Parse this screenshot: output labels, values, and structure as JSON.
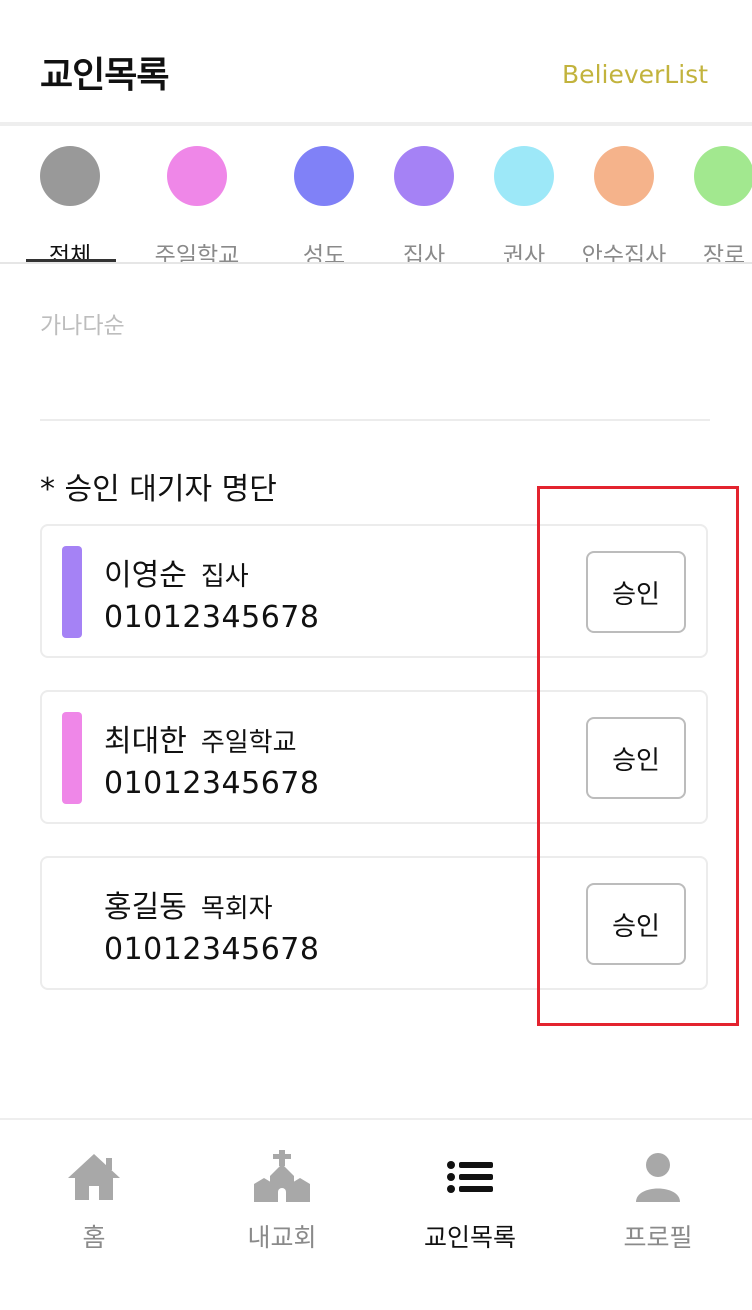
{
  "header": {
    "title": "교인목록",
    "subtitle": "BelieverList"
  },
  "categories": [
    {
      "label": "전체",
      "color": "#999999",
      "active": true
    },
    {
      "label": "주일학교",
      "color": "#ef87e8"
    },
    {
      "label": "성도",
      "color": "#8081f7"
    },
    {
      "label": "집사",
      "color": "#a582f5"
    },
    {
      "label": "권사",
      "color": "#9de8f8"
    },
    {
      "label": "안수집사",
      "color": "#f5b38b"
    },
    {
      "label": "장로",
      "color": "#a2e88f"
    }
  ],
  "sort": {
    "label": "가나다순"
  },
  "pending": {
    "title": "* 승인 대기자 명단",
    "members": [
      {
        "name": "이영순",
        "role": "집사",
        "phone": "01012345678",
        "bar_color": "#a582f5",
        "action": "승인"
      },
      {
        "name": "최대한",
        "role": "주일학교",
        "phone": "01012345678",
        "bar_color": "#ef87e8",
        "action": "승인"
      },
      {
        "name": "홍길동",
        "role": "목회자",
        "phone": "01012345678",
        "bar_color": "",
        "action": "승인"
      }
    ]
  },
  "bottom_nav": [
    {
      "label": "홈",
      "icon": "home-icon"
    },
    {
      "label": "내교회",
      "icon": "church-icon"
    },
    {
      "label": "교인목록",
      "icon": "list-icon",
      "active": true
    },
    {
      "label": "프로필",
      "icon": "person-icon"
    }
  ],
  "colors": {
    "accent": "#c2b33d",
    "highlight": "#e3232f",
    "inactive": "#8a8a8a"
  }
}
